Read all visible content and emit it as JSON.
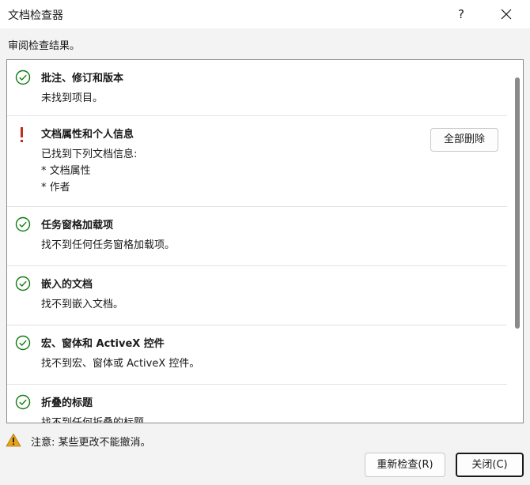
{
  "window": {
    "title": "文档检查器",
    "help_label": "?"
  },
  "instruction": "审阅检查结果。",
  "items": [
    {
      "title": "批注、修订和版本",
      "status": "ok",
      "lines": [
        "未找到项目。"
      ]
    },
    {
      "title": "文档属性和个人信息",
      "status": "found",
      "lines": [
        "已找到下列文档信息:",
        "* 文档属性",
        "* 作者"
      ],
      "action_label": "全部删除"
    },
    {
      "title": "任务窗格加载项",
      "status": "ok",
      "lines": [
        "找不到任何任务窗格加载项。"
      ]
    },
    {
      "title": "嵌入的文档",
      "status": "ok",
      "lines": [
        "找不到嵌入文档。"
      ]
    },
    {
      "title": "宏、窗体和 ActiveX 控件",
      "status": "ok",
      "lines": [
        "找不到宏、窗体或 ActiveX 控件。"
      ]
    },
    {
      "title": "折叠的标题",
      "status": "ok",
      "lines": [
        "找不到任何折叠的标题。"
      ]
    }
  ],
  "footer": {
    "note": "注意: 某些更改不能撤消。",
    "reinspect_label": "重新检查(R)",
    "close_label": "关闭(C)"
  },
  "colors": {
    "ok": "#107c10",
    "warn": "#c42b1c",
    "caution": "#e8a317"
  }
}
